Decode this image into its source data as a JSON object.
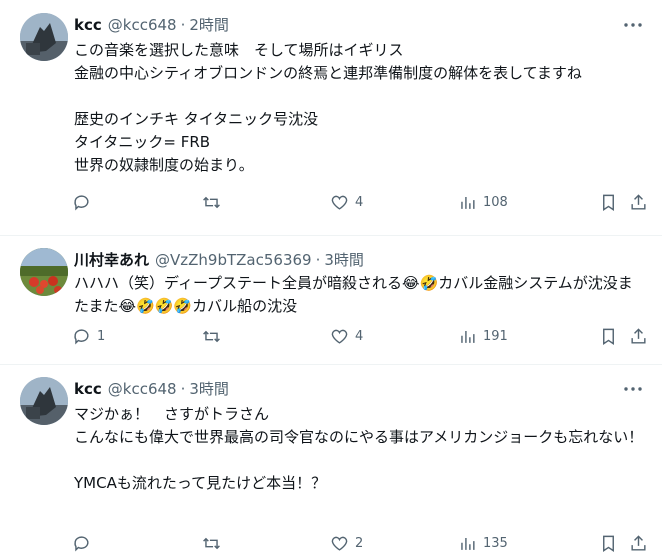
{
  "tweets": [
    {
      "name": "kcc",
      "handle": "@kcc648",
      "dot": "·",
      "time": "2時間",
      "text": "この音楽を選択した意味　そして場所はイギリス\n金融の中心シティオブロンドンの終焉と連邦準備制度の解体を表してますね\n\n歴史のインチキ タイタニック号沈没\nタイタニック= FRB\n世界の奴隷制度の始まり。",
      "replies": "",
      "retweets": "",
      "likes": "4",
      "views": "108"
    },
    {
      "name": "川村幸あれ",
      "handle": "@VzZh9bTZac56369",
      "dot": "·",
      "time": "3時間",
      "text": "ハハハ（笑）ディープステート全員が暗殺される😂🤣カバル金融システムが沈没またまた😂🤣🤣🤣カバル船の沈没",
      "replies": "1",
      "retweets": "",
      "likes": "4",
      "views": "191"
    },
    {
      "name": "kcc",
      "handle": "@kcc648",
      "dot": "·",
      "time": "3時間",
      "text": "マジかぁ！　さすがトラさん\nこんなにも偉大で世界最高の司令官なのにやる事はアメリカンジョークも忘れない！\n\nYMCAも流れたって見たけど本当！？",
      "replies": "",
      "retweets": "",
      "likes": "2",
      "views": "135"
    }
  ],
  "icons": {
    "more": "more-icon",
    "reply": "reply-icon",
    "retweet": "retweet-icon",
    "like": "heart-icon",
    "views": "views-icon",
    "bookmark": "bookmark-icon",
    "share": "share-icon"
  },
  "colors": {
    "text": "#0f1419",
    "secondary": "#536471",
    "divider": "#eff3f4"
  }
}
